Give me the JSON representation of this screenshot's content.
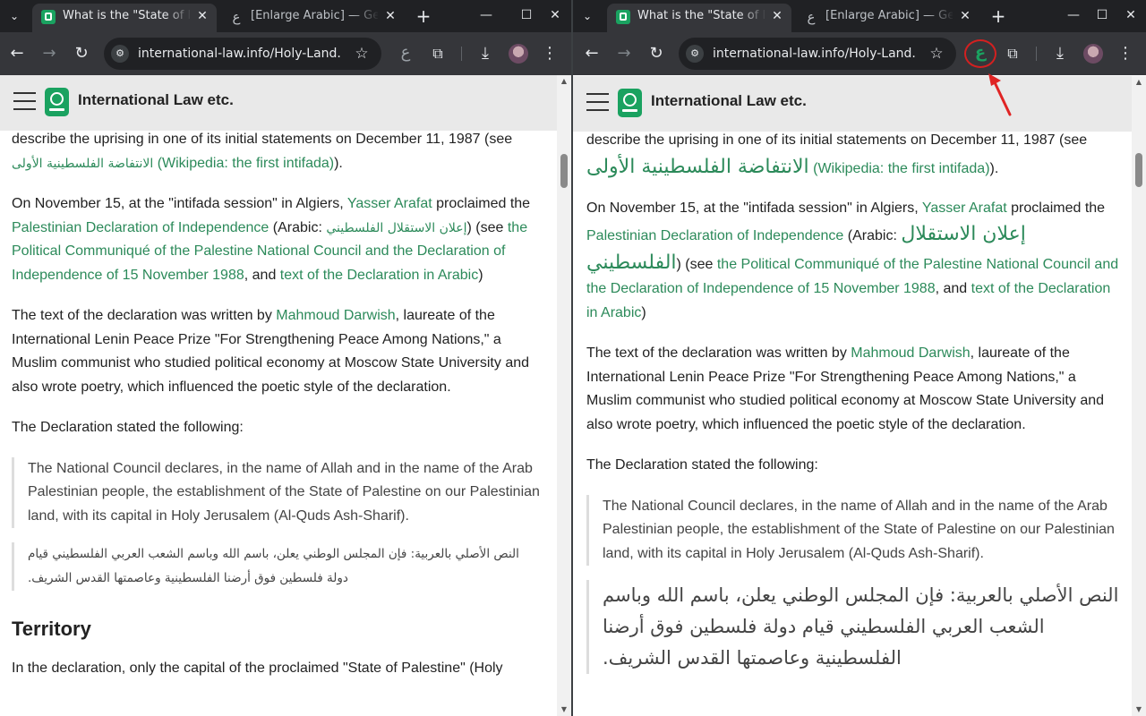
{
  "left": {
    "tabs": [
      {
        "title": "What is the \"State of Pa",
        "active": true
      },
      {
        "title": "[Enlarge Arabic] — Ger",
        "active": false
      }
    ],
    "url": "international-law.info/Holy-Land...",
    "brand": "International Law etc."
  },
  "right": {
    "tabs": [
      {
        "title": "What is the \"State of Pa",
        "active": true
      },
      {
        "title": "[Enlarge Arabic] — Ger",
        "active": false
      }
    ],
    "url": "international-law.info/Holy-Land...",
    "brand": "International Law etc."
  },
  "icons": {
    "ain": "ع",
    "star": "☆",
    "back": "←",
    "forward": "→",
    "reload": "↻",
    "menu": "⋮",
    "close": "✕",
    "plus": "+",
    "download": "⤓",
    "puzzle": "⧉",
    "minimize": "—",
    "maximize": "☐",
    "chevron": "⌄"
  },
  "article": {
    "p1_text": "describe the uprising in one of its initial statements on December 11, 1987 (see ",
    "p1_arabic_link": "الانتفاضة الفلسطينية الأولى",
    "p1_link": "(Wikipedia: the first intifada)",
    "p1_end": ").",
    "p2_a": "On November 15, at the \"intifada session\" in Algiers, ",
    "p2_link_arafat": "Yasser Arafat",
    "p2_b": " proclaimed the ",
    "p2_link_declaration": "Palestinian Declaration of Independence",
    "p2_c": " (Arabic: ",
    "p2_arabic": "إعلان الاستقلال الفلسطيني",
    "p2_d": ") (see ",
    "p2_link_communique": "the Political Communiqué of the Palestine National Council and the Declaration of Independence of 15 November 1988",
    "p2_e": ", and ",
    "p2_link_text": "text of the Declaration in Arabic",
    "p2_f": ")",
    "p3_a": "The text of the declaration was written by ",
    "p3_link": "Mahmoud Darwish",
    "p3_b": ", laureate of the International Lenin Peace Prize \"For Strengthening Peace Among Nations,\" a Muslim communist who studied political economy at Moscow State University and also wrote poetry, which influenced the poetic style of the declaration.",
    "p4": "The Declaration stated the following:",
    "quote_en": "The National Council declares, in the name of Allah and in the name of the Arab Palestinian people, the establishment of the State of Palestine on our Palestinian land, with its capital in Holy Jerusalem (Al-Quds Ash-Sharif).",
    "quote_ar": "النص الأصلي بالعربية: فإن المجلس الوطني يعلن، باسم الله وباسم الشعب العربي الفلسطيني قيام دولة فلسطين فوق أرضنا الفلسطينية وعاصمتها القدس الشريف.",
    "h_territory": "Territory",
    "p5": "In the declaration, only the capital of the proclaimed \"State of Palestine\" (Holy"
  }
}
